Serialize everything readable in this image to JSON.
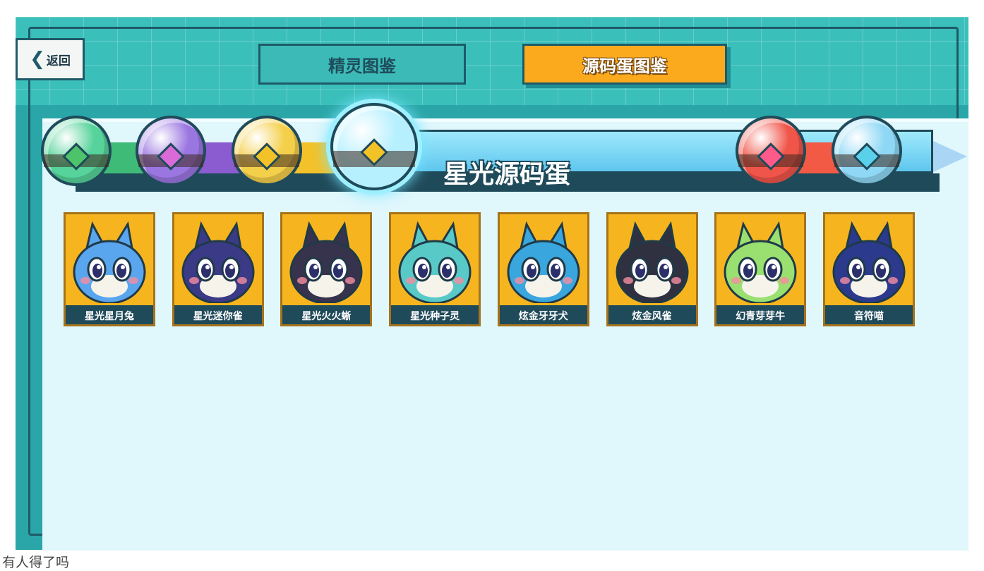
{
  "header": {
    "back_label": "返回",
    "tabs": [
      {
        "label": "精灵图鉴",
        "selected": false
      },
      {
        "label": "源码蛋图鉴",
        "selected": true
      }
    ]
  },
  "eggs": {
    "selected_title": "星光源码蛋",
    "items": [
      {
        "name": "green-egg",
        "color": "#56d39a",
        "gem": "#4dc36a"
      },
      {
        "name": "purple-egg",
        "color": "#9a76e0",
        "gem": "#d86bd8"
      },
      {
        "name": "gold-egg",
        "color": "#f4cf4a",
        "gem": "#f2c227"
      },
      {
        "name": "starlight-egg",
        "color": "#b6f0ff",
        "gem": "#f2c227"
      },
      {
        "name": "red-egg",
        "color": "#f0554a",
        "gem": "#ff5a8a"
      },
      {
        "name": "ice-egg",
        "color": "#8fd8f5",
        "gem": "#5ad1ea"
      }
    ]
  },
  "creatures": [
    {
      "name": "星光星月兔",
      "color": "#5aa6ee"
    },
    {
      "name": "星光迷你雀",
      "color": "#3b3a86"
    },
    {
      "name": "星光火火蜥",
      "color": "#37334d"
    },
    {
      "name": "星光种子灵",
      "color": "#58c9c7"
    },
    {
      "name": "炫金牙牙犬",
      "color": "#3aa6de"
    },
    {
      "name": "炫金风雀",
      "color": "#2f3140"
    },
    {
      "name": "幻青芽芽牛",
      "color": "#9ae070"
    },
    {
      "name": "音符喵",
      "color": "#2b3a8c"
    }
  ],
  "caption": "有人得了吗"
}
